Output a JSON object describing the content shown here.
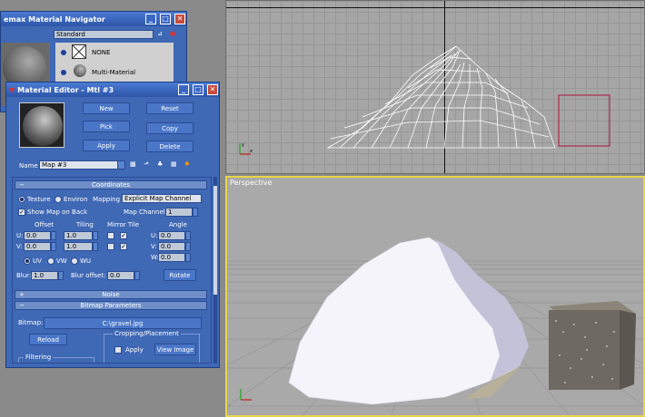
{
  "navigator": {
    "title": "emax Material Navigator",
    "dropdown": "Standard",
    "items": [
      "NONE",
      "Multi-Material"
    ]
  },
  "editor": {
    "title": "Material Editor - Mtl #3",
    "buttons": {
      "new": "New",
      "reset": "Reset",
      "pick": "Pick",
      "copy": "Copy",
      "apply": "Apply",
      "delete": "Delete"
    },
    "name_label": "Name",
    "name_value": "Map #3",
    "coordinates": {
      "header": "Coordinates",
      "texture": "Texture",
      "environ": "Environ",
      "mapping_label": "Mapping",
      "mapping_value": "Explicit Map Channel",
      "show_map": "Show Map on Back",
      "map_channel_label": "Map Channel:",
      "map_channel_value": "1",
      "offset": "Offset",
      "tiling": "Tiling",
      "mirror_tile": "Mirror Tile",
      "angle": "Angle",
      "u": "U:",
      "v": "V:",
      "w": "W:",
      "offset_u": "0.0",
      "offset_v": "0.0",
      "tiling_u": "1.0",
      "tiling_v": "1.0",
      "angle_u": "0.0",
      "angle_v": "0.0",
      "angle_w": "0.0",
      "uv": "UV",
      "vw": "VW",
      "wu": "WU",
      "blur_label": "Blur:",
      "blur_value": "1.0",
      "blur_offset_label": "Blur offset:",
      "blur_offset_value": "0.0",
      "rotate": "Rotate"
    },
    "noise": {
      "header": "Noise"
    },
    "bitmap": {
      "header": "Bitmap Parameters",
      "bitmap_label": "Bitmap:",
      "bitmap_path": "C:\\gravel.jpg",
      "reload": "Reload",
      "cropping": "Cropping/Placement",
      "apply": "Apply",
      "view_image": "View Image",
      "filtering": "Filtering"
    }
  },
  "viewports": {
    "perspective_label": "Perspective"
  },
  "colors": {
    "accent": "#3f68b5",
    "viewport_active": "#e8d44a",
    "gizmo": "#b0103a"
  }
}
